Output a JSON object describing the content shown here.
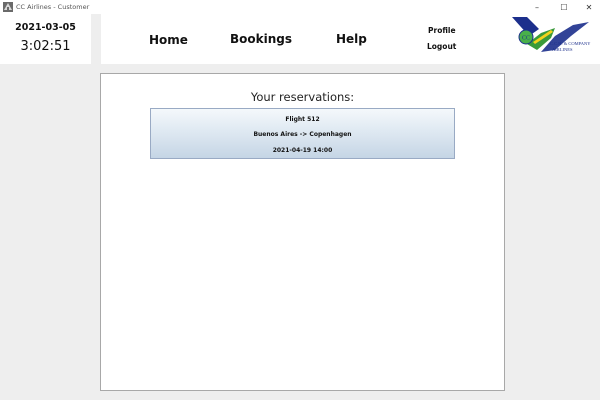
{
  "window": {
    "title": "CC Airlines - Customer",
    "controls": {
      "minimize": "–",
      "maximize": "☐",
      "close": "✕"
    }
  },
  "clock": {
    "date": "2021-03-05",
    "time": "3:02:51"
  },
  "nav": {
    "home": "Home",
    "bookings": "Bookings",
    "help": "Help",
    "profile": "Profile",
    "logout": "Logout"
  },
  "logo": {
    "badge": "CC",
    "line1": "C.C.H. & COMPANY",
    "line2": "AIRLINES"
  },
  "main": {
    "heading": "Your reservations:",
    "reservations": [
      {
        "flight": "Flight 512",
        "route": "Buenos Aires -> Copenhagen",
        "datetime": "2021-04-19 14:00"
      }
    ]
  },
  "colors": {
    "background": "#eeeeee",
    "panel": "#ffffff",
    "logo_navy": "#1c2f8c",
    "logo_green": "#3a9a3a",
    "card_gradient_top": "#f4f8fb",
    "card_gradient_bottom": "#c5d5e5"
  },
  "icons": {
    "app": "airline-app-icon",
    "minimize": "minimize-icon",
    "maximize": "maximize-icon",
    "close": "close-icon"
  }
}
